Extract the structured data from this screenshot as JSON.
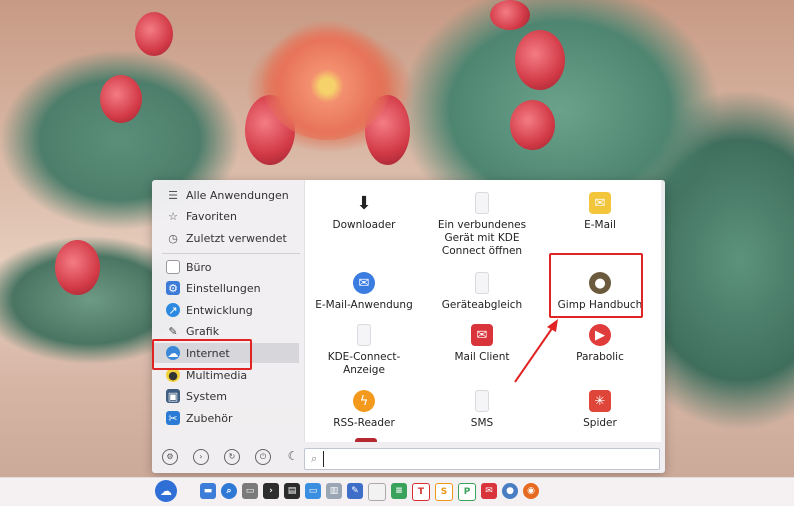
{
  "sidebar": {
    "items": [
      {
        "label": "Alle Anwendungen",
        "icon": "list-icon"
      },
      {
        "label": "Favoriten",
        "icon": "star-icon"
      },
      {
        "label": "Zuletzt verwendet",
        "icon": "clock-icon"
      },
      {
        "label": "Büro",
        "icon": "office-icon"
      },
      {
        "label": "Einstellungen",
        "icon": "settings-icon"
      },
      {
        "label": "Entwicklung",
        "icon": "development-icon"
      },
      {
        "label": "Grafik",
        "icon": "graphics-icon"
      },
      {
        "label": "Internet",
        "icon": "internet-icon"
      },
      {
        "label": "Multimedia",
        "icon": "multimedia-icon"
      },
      {
        "label": "System",
        "icon": "system-icon"
      },
      {
        "label": "Zubehör",
        "icon": "accessories-icon"
      }
    ],
    "active": "Internet"
  },
  "apps": [
    {
      "label": "Downloader",
      "icon": "downloader-icon"
    },
    {
      "label": "Ein verbundenes Gerät mit KDE Connect öffnen",
      "icon": "device-icon"
    },
    {
      "label": "E-Mail",
      "icon": "email-icon"
    },
    {
      "label": "E-Mail-Anwendung",
      "icon": "thunderbird-icon"
    },
    {
      "label": "Geräteabgleich",
      "icon": "device-icon"
    },
    {
      "label": "Gimp Handbuch",
      "icon": "gimp-icon"
    },
    {
      "label": "KDE-Connect-Anzeige",
      "icon": "device-icon"
    },
    {
      "label": "Mail Client",
      "icon": "mail-client-icon"
    },
    {
      "label": "Parabolic",
      "icon": "parabolic-icon"
    },
    {
      "label": "RSS-Reader",
      "icon": "rss-icon"
    },
    {
      "label": "SMS",
      "icon": "device-icon"
    },
    {
      "label": "Spider",
      "icon": "spider-icon"
    }
  ],
  "search": {
    "placeholder": ""
  },
  "bottom_actions": [
    "settings-icon",
    "next-icon",
    "refresh-icon",
    "power-icon",
    "night-icon"
  ],
  "taskbar": {
    "icons": [
      "files-icon",
      "search-icon",
      "drive-icon",
      "terminal-icon",
      "screen-icon",
      "window-icon",
      "archive-icon",
      "pdf-icon",
      "document-icon",
      "stack-icon",
      "text-icon",
      "spreadsheet-icon",
      "presentation-icon",
      "mail-icon",
      "github-icon",
      "firefox-icon"
    ],
    "letters": {
      "text": "T",
      "spreadsheet": "S",
      "presentation": "P"
    }
  },
  "colors": {
    "highlight": "#e02424",
    "accent": "#2f6fd6"
  }
}
